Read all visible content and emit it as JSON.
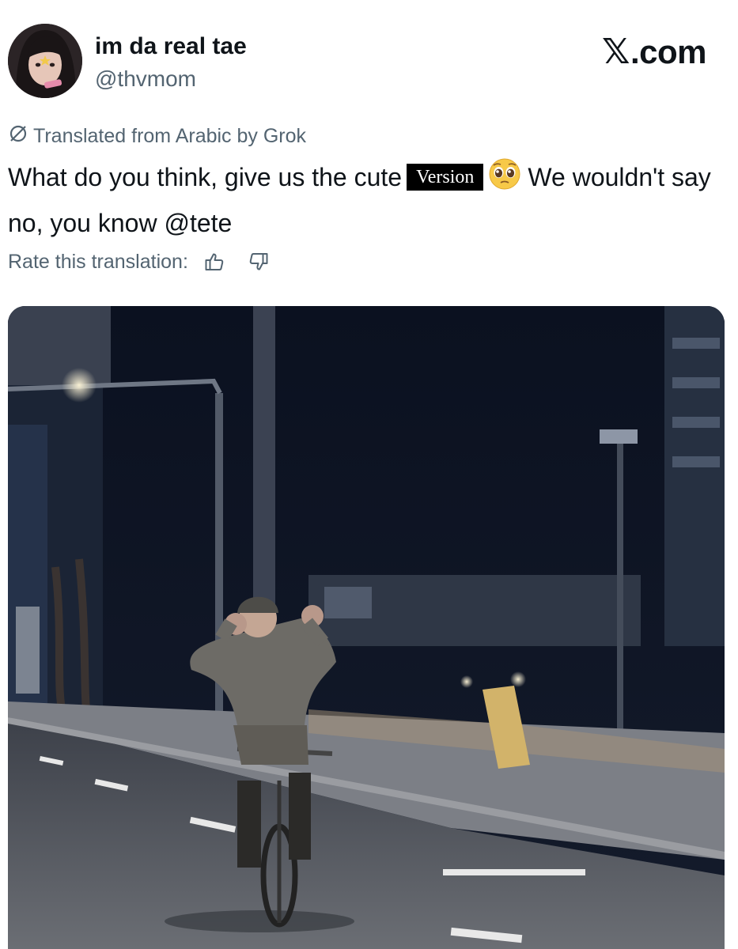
{
  "author": {
    "display_name": "im da real tae",
    "handle": "@thvmom",
    "avatar_icon": "profile-photo"
  },
  "brand": {
    "label": ".com",
    "mark": "𝕏"
  },
  "translation": {
    "note": "Translated from Arabic by Grok",
    "icon": "translate-slash-icon"
  },
  "tweet": {
    "text_part1": "What do you think, give us the cute",
    "overlay_word": "Version",
    "emoji": "pleading-face",
    "text_part2": "We wouldn't say no, you know @tete"
  },
  "rating": {
    "label": "Rate this translation:",
    "up_icon": "thumbs-up-icon",
    "down_icon": "thumbs-down-icon"
  },
  "media": {
    "type": "video",
    "description_icon": "night-street-cyclist-frame"
  },
  "colors": {
    "text_primary": "#0f1419",
    "text_secondary": "#536471",
    "background": "#ffffff"
  }
}
